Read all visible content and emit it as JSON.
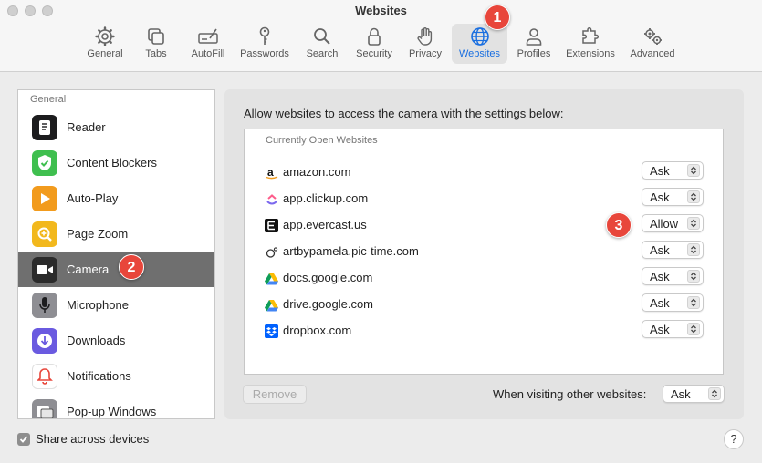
{
  "window": {
    "title": "Websites"
  },
  "toolbar": {
    "items": [
      {
        "label": "General",
        "icon": "gear-icon"
      },
      {
        "label": "Tabs",
        "icon": "tabs-icon"
      },
      {
        "label": "AutoFill",
        "icon": "autofill-icon"
      },
      {
        "label": "Passwords",
        "icon": "key-icon"
      },
      {
        "label": "Search",
        "icon": "search-icon"
      },
      {
        "label": "Security",
        "icon": "lock-icon"
      },
      {
        "label": "Privacy",
        "icon": "hand-icon"
      },
      {
        "label": "Websites",
        "icon": "globe-icon",
        "active": true
      },
      {
        "label": "Profiles",
        "icon": "person-icon"
      },
      {
        "label": "Extensions",
        "icon": "puzzle-icon"
      },
      {
        "label": "Advanced",
        "icon": "gears-icon"
      }
    ]
  },
  "badges": {
    "one": "1",
    "two": "2",
    "three": "3"
  },
  "sidebar": {
    "header": "General",
    "items": [
      {
        "label": "Reader",
        "icon": "reader-icon",
        "color": "#1c1c1e"
      },
      {
        "label": "Content Blockers",
        "icon": "shield-check-icon",
        "color": "#3fbf4f"
      },
      {
        "label": "Auto-Play",
        "icon": "play-icon",
        "color": "#f29b1d"
      },
      {
        "label": "Page Zoom",
        "icon": "zoom-icon",
        "color": "#f2b81d"
      },
      {
        "label": "Camera",
        "icon": "camera-icon",
        "color": "#2b2b2b",
        "selected": true
      },
      {
        "label": "Microphone",
        "icon": "microphone-icon",
        "color": "#8e8e93"
      },
      {
        "label": "Downloads",
        "icon": "download-icon",
        "color": "#6a5ae0"
      },
      {
        "label": "Notifications",
        "icon": "bell-icon",
        "color": "#ffffff"
      },
      {
        "label": "Pop-up Windows",
        "icon": "popup-windows-icon",
        "color": "#8e8e93"
      }
    ]
  },
  "main": {
    "description": "Allow websites to access the camera with the settings below:",
    "section_header": "Currently Open Websites",
    "sites": [
      {
        "name": "amazon.com",
        "setting": "Ask",
        "icon": "amazon-icon"
      },
      {
        "name": "app.clickup.com",
        "setting": "Ask",
        "icon": "clickup-icon"
      },
      {
        "name": "app.evercast.us",
        "setting": "Allow",
        "icon": "evercast-icon"
      },
      {
        "name": "artbypamela.pic-time.com",
        "setting": "Ask",
        "icon": "pictime-icon"
      },
      {
        "name": "docs.google.com",
        "setting": "Ask",
        "icon": "google-drive-icon"
      },
      {
        "name": "drive.google.com",
        "setting": "Ask",
        "icon": "google-drive-icon"
      },
      {
        "name": "dropbox.com",
        "setting": "Ask",
        "icon": "dropbox-icon"
      }
    ],
    "remove_label": "Remove",
    "other_label": "When visiting other websites:",
    "other_setting": "Ask"
  },
  "footer": {
    "share_label": "Share across devices",
    "share_checked": true,
    "help_label": "?"
  },
  "colors": {
    "accent": "#1a6fe0",
    "badge": "#e8463b",
    "selected_row": "#6f6f6f"
  }
}
